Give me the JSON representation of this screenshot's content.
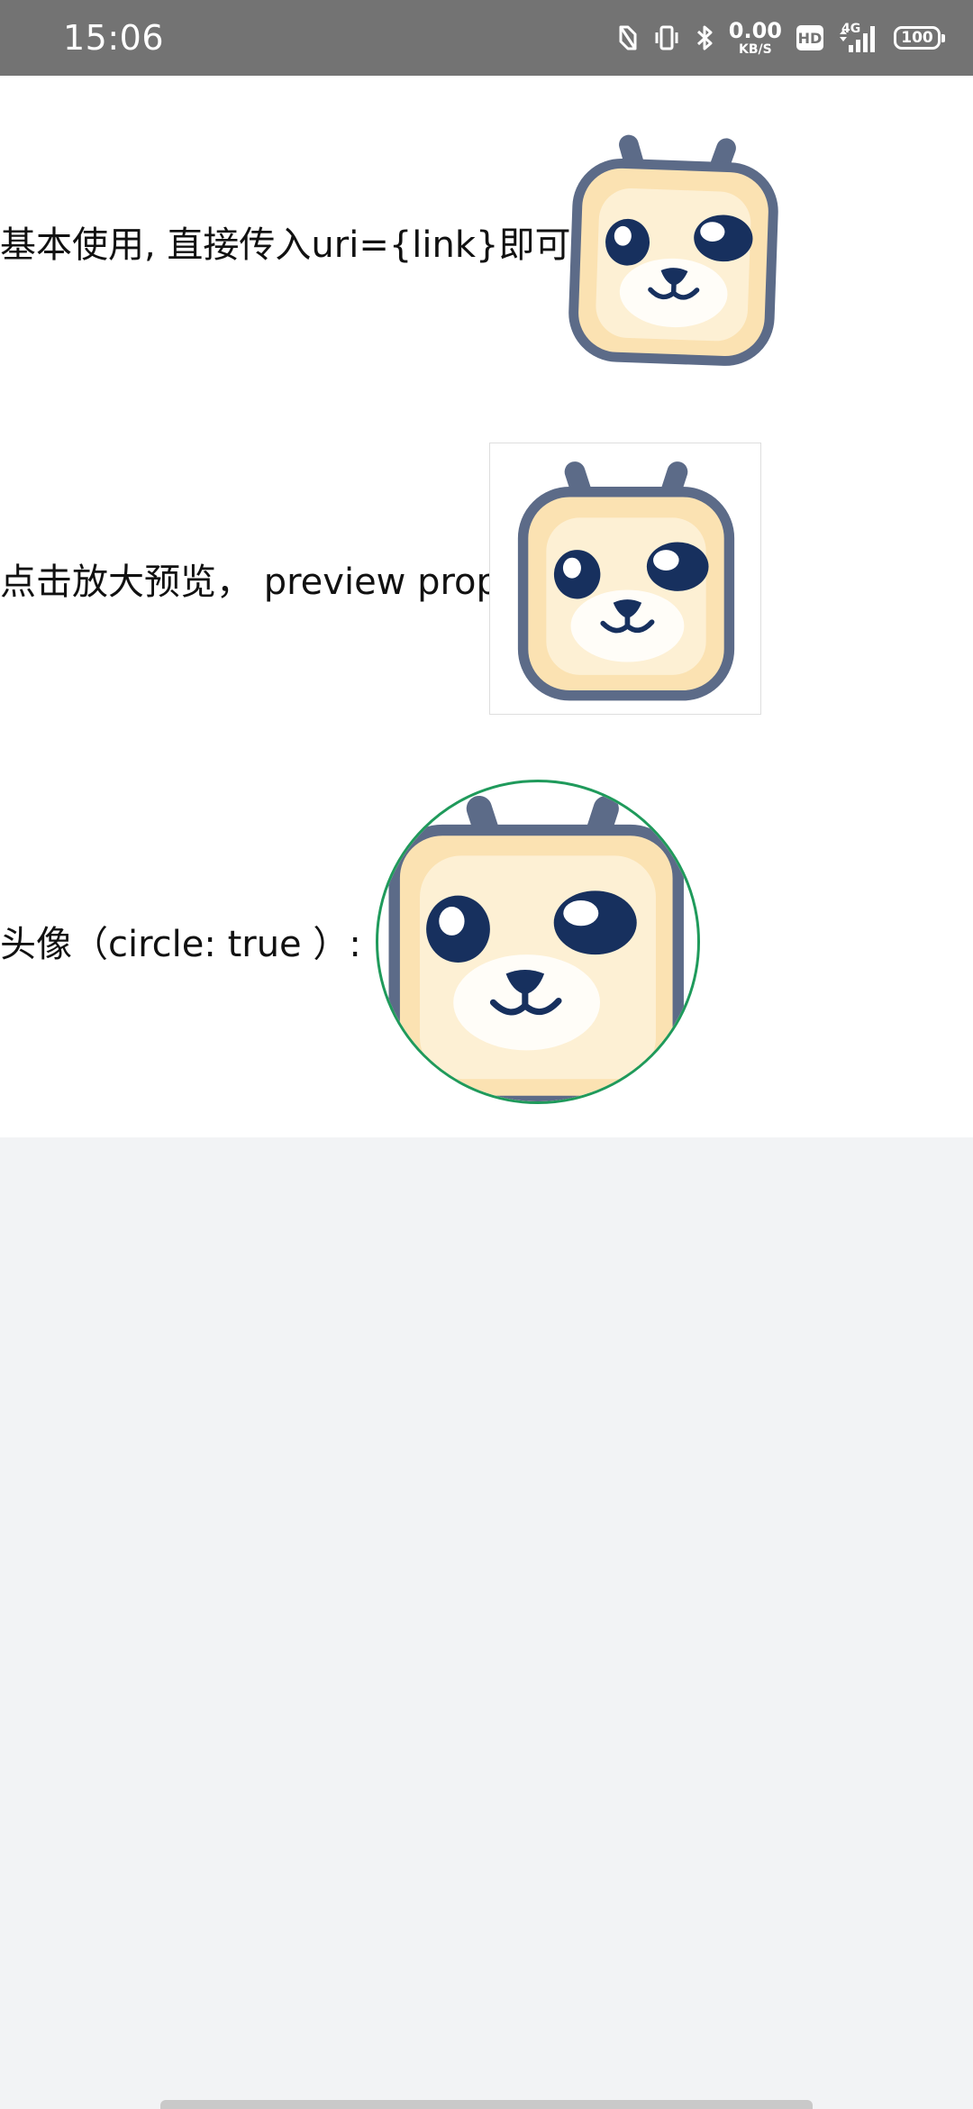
{
  "status_bar": {
    "time": "15:06",
    "net_speed_value": "0.00",
    "net_speed_unit": "KB/S",
    "hd_label": "HD",
    "network_type": "4G",
    "battery_level": "100",
    "icons": [
      "nfc-icon",
      "vibrate-icon",
      "bluetooth-icon",
      "hd-icon",
      "signal-icon",
      "battery-icon"
    ]
  },
  "demo": {
    "basic_label": "基本使用, 直接传入uri={link}即可",
    "preview_label": "点击放大预览， preview prop",
    "avatar_label": "头像（circle: true ）:"
  },
  "colors": {
    "status_bar_bg": "#737373",
    "avatar_border": "#1f9a5b",
    "page_bg": "#f2f3f5",
    "content_bg": "#ffffff"
  }
}
